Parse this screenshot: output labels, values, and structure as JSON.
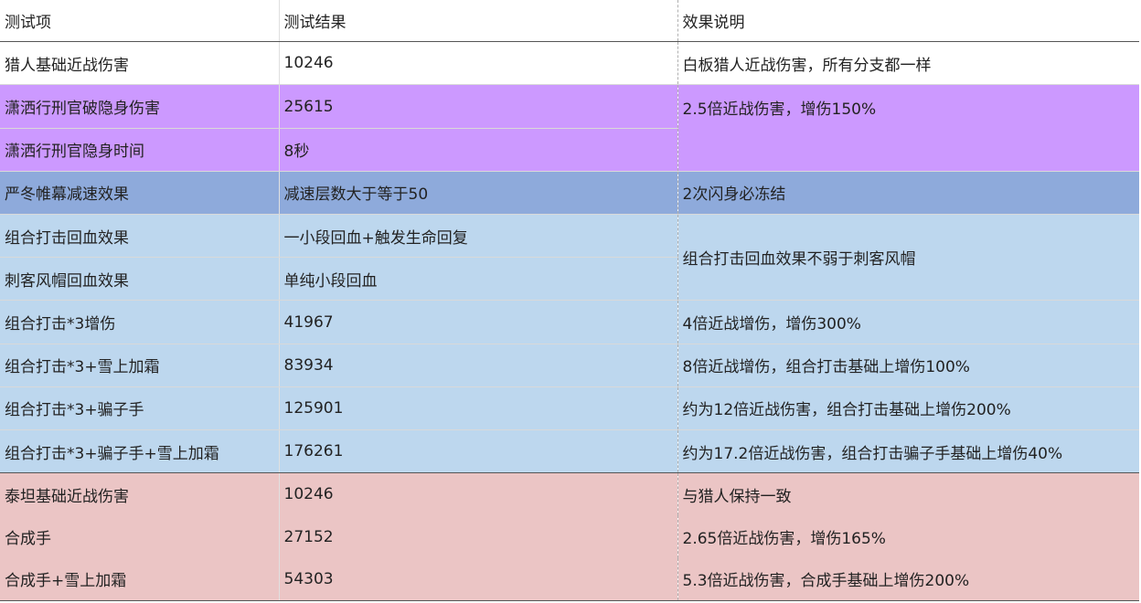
{
  "table": {
    "headers": [
      "测试项",
      "测试结果",
      "效果说明"
    ],
    "colors": {
      "white": "#ffffff",
      "purple": "#cc99ff",
      "blue_dark": "#8eaadb",
      "blue_light": "#bdd7ee",
      "pink": "#ebc5c5"
    },
    "rows": [
      {
        "item": "猎人基础近战伤害",
        "result": "10246",
        "note": "白板猎人近战伤害，所有分支都一样"
      },
      {
        "item": "潇洒行刑官破隐身伤害",
        "result": "25615",
        "note": "2.5倍近战伤害，增伤150%"
      },
      {
        "item": "潇洒行刑官隐身时间",
        "result": "8秒",
        "note": ""
      },
      {
        "item": "严冬帷幕减速效果",
        "result": "减速层数大于等于50",
        "note": "2次闪身必冻结"
      },
      {
        "item": "组合打击回血效果",
        "result": "一小段回血+触发生命回复",
        "note": "组合打击回血效果不弱于刺客风帽"
      },
      {
        "item": "刺客风帽回血效果",
        "result": "单纯小段回血",
        "note": ""
      },
      {
        "item": "组合打击*3增伤",
        "result": "41967",
        "note": "4倍近战增伤，增伤300%"
      },
      {
        "item": "组合打击*3+雪上加霜",
        "result": "83934",
        "note": "8倍近战增伤，组合打击基础上增伤100%"
      },
      {
        "item": "组合打击*3+骗子手",
        "result": "125901",
        "note": "约为12倍近战伤害，组合打击基础上增伤200%"
      },
      {
        "item": "组合打击*3+骗子手+雪上加霜",
        "result": "176261",
        "note": "约为17.2倍近战伤害，组合打击骗子手基础上增伤40%"
      },
      {
        "item": "泰坦基础近战伤害",
        "result": "10246",
        "note": "与猎人保持一致"
      },
      {
        "item": "合成手",
        "result": "27152",
        "note": "2.65倍近战伤害，增伤165%"
      },
      {
        "item": "合成手+雪上加霜",
        "result": "54303",
        "note": "5.3倍近战伤害，合成手基础上增伤200%"
      }
    ]
  }
}
